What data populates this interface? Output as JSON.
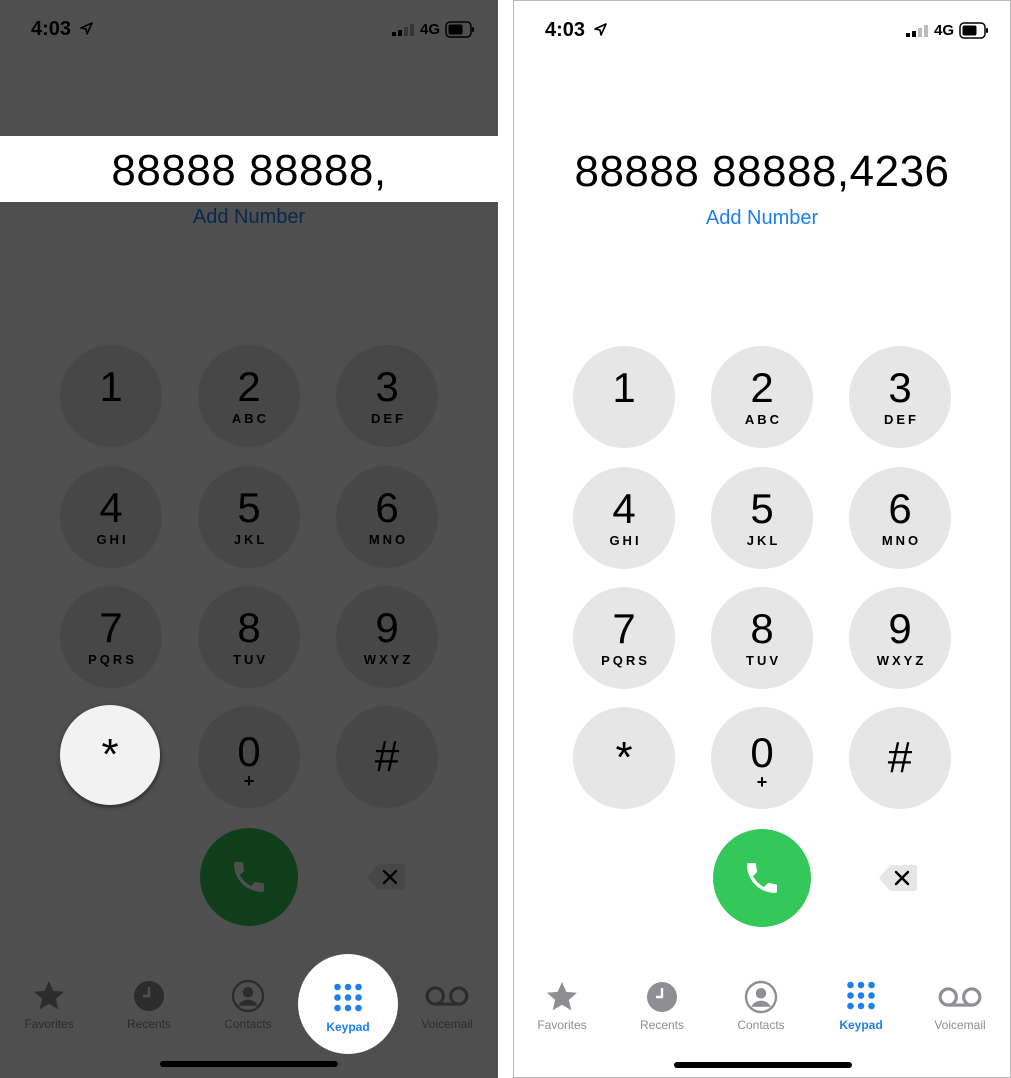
{
  "status_bar": {
    "time": "4:03",
    "network": "4G"
  },
  "left_panel": {
    "number": "88888 88888,"
  },
  "right_panel": {
    "number": "88888 88888,4236"
  },
  "add_number_label": "Add Number",
  "keys": [
    {
      "digit": "1",
      "letters": ""
    },
    {
      "digit": "2",
      "letters": "ABC"
    },
    {
      "digit": "3",
      "letters": "DEF"
    },
    {
      "digit": "4",
      "letters": "GHI"
    },
    {
      "digit": "5",
      "letters": "JKL"
    },
    {
      "digit": "6",
      "letters": "MNO"
    },
    {
      "digit": "7",
      "letters": "PQRS"
    },
    {
      "digit": "8",
      "letters": "TUV"
    },
    {
      "digit": "9",
      "letters": "WXYZ"
    },
    {
      "digit": "*",
      "letters": ""
    },
    {
      "digit": "0",
      "letters": "+"
    },
    {
      "digit": "#",
      "letters": ""
    }
  ],
  "tabs": [
    {
      "label": "Favorites",
      "icon": "star-icon"
    },
    {
      "label": "Recents",
      "icon": "clock-icon"
    },
    {
      "label": "Contacts",
      "icon": "person-icon"
    },
    {
      "label": "Keypad",
      "icon": "keypad-icon",
      "active": true
    },
    {
      "label": "Voicemail",
      "icon": "voicemail-icon"
    }
  ],
  "colors": {
    "accent": "#1e7ff0",
    "call_green": "#34c759",
    "key_background": "#e6e6e6",
    "inactive_tab": "#8e8e93"
  }
}
